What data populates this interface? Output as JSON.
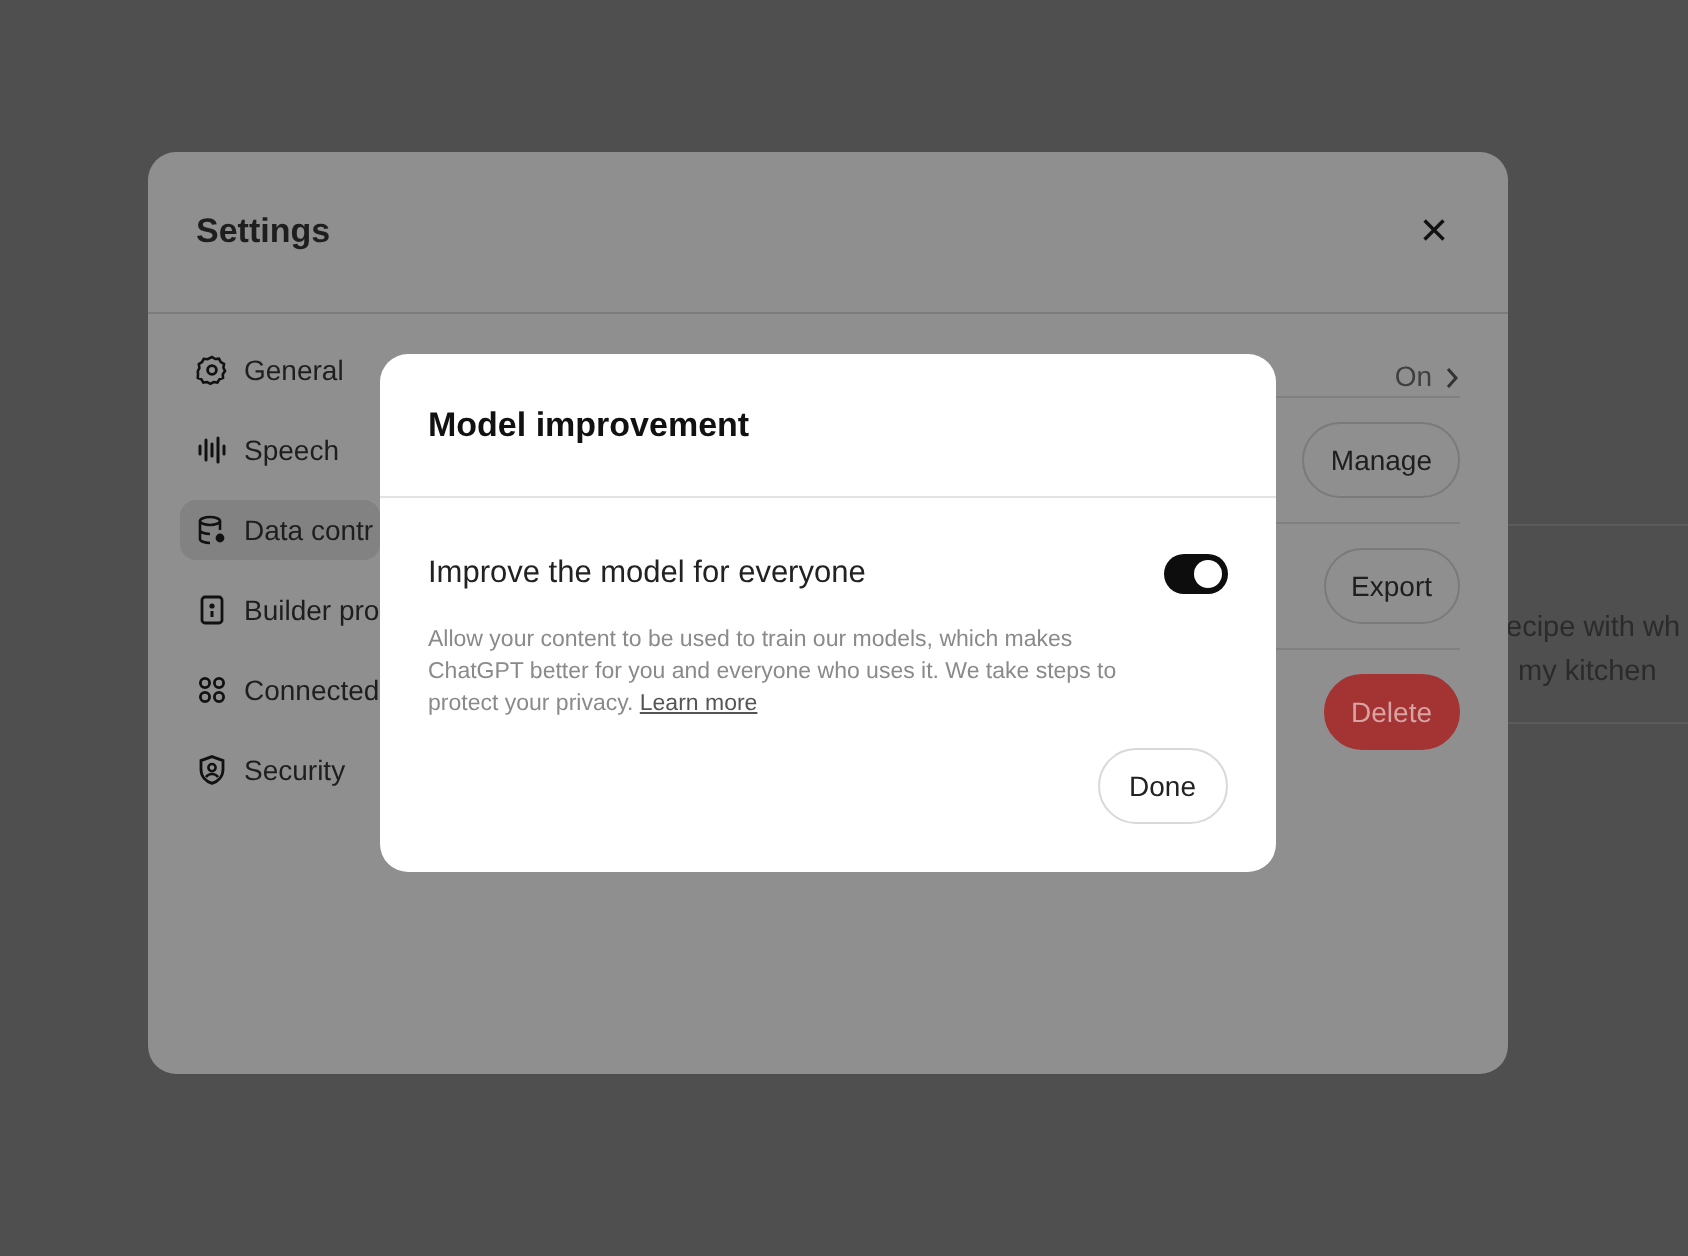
{
  "background_card": {
    "lines": [
      "ecipe with wh",
      "my kitchen"
    ]
  },
  "settings": {
    "title": "Settings",
    "close": "×",
    "sidebar": [
      {
        "label": "General",
        "selected": false
      },
      {
        "label": "Speech",
        "selected": false
      },
      {
        "label": "Data contr",
        "selected": true
      },
      {
        "label": "Builder pro",
        "selected": false
      },
      {
        "label": "Connected",
        "selected": false
      },
      {
        "label": "Security",
        "selected": false
      }
    ],
    "rows": [
      {
        "kind": "value",
        "text": "On"
      },
      {
        "kind": "button",
        "text": "Manage"
      },
      {
        "kind": "button",
        "text": "Export"
      },
      {
        "kind": "danger",
        "text": "Delete"
      }
    ]
  },
  "dialog": {
    "title": "Model improvement",
    "toggle": {
      "label": "Improve the model for everyone",
      "on": true
    },
    "description": "Allow your content to be used to train our models, which makes ChatGPT better for you and everyone who uses it. We take steps to protect your privacy.",
    "link": "Learn more",
    "done": "Done"
  }
}
